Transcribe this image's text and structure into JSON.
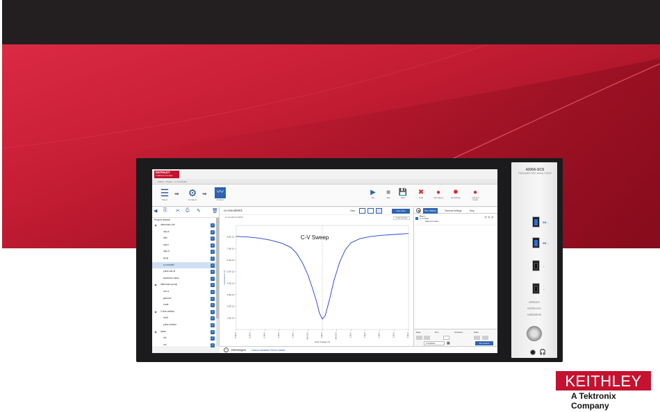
{
  "brand": {
    "name": "KEITHLEY",
    "tagline": "A Tektronix Company",
    "color": "#c41230"
  },
  "instrument": {
    "model": "4200A-SCS",
    "model_desc": "PARAMETER ANALYZER",
    "panel_labels": [
      "OPERATE",
      "INTERLOCK",
      "HARDDRIVE"
    ],
    "usb_tags": [
      "SS←",
      "SS←",
      "←",
      "←"
    ]
  },
  "screen": {
    "logo": "KEITHLEY",
    "logo_sub": "A Tektronix Company",
    "window_title": "Clarius - Project - cv-nmosfet#1",
    "toolbar": {
      "steps": [
        "Select",
        "Configure",
        "Analyze"
      ],
      "right_buttons": [
        "Run",
        "Stop",
        "Save",
        "Tools",
        "My Projects",
        "My Settings",
        "Learning Center"
      ]
    },
    "tree": {
      "tools": [
        "Copy",
        "Cut",
        "Paste",
        "Rename",
        "Delete"
      ],
      "project_label": "Project: default",
      "items": [
        {
          "label": "4terminal-n-fet",
          "level": 1,
          "group": true
        },
        {
          "label": "vds-id",
          "level": 2
        },
        {
          "label": "vtlin",
          "level": 2
        },
        {
          "label": "subvt",
          "level": 2
        },
        {
          "label": "vgs-id",
          "level": 2
        },
        {
          "label": "ig-vg",
          "level": 2
        },
        {
          "label": "cv-nmosfet",
          "level": 2,
          "selected": true
        },
        {
          "label": "pulse-vds-id",
          "level": 2
        },
        {
          "label": "waveform-meas",
          "level": 2
        },
        {
          "label": "3terminal-npn-bjt",
          "level": 1,
          "group": true
        },
        {
          "label": "vce-ic",
          "level": 2
        },
        {
          "label": "gummel",
          "level": 2
        },
        {
          "label": "vcsat",
          "level": 2
        },
        {
          "label": "2-wire-resistor",
          "level": 1,
          "group": true
        },
        {
          "label": "res2t",
          "level": 2
        },
        {
          "label": "pulse-resistor",
          "level": 2
        },
        {
          "label": "diode",
          "level": 1,
          "group": true
        },
        {
          "label": "vfd",
          "level": 2
        },
        {
          "label": "vrd",
          "level": 2
        }
      ]
    },
    "graph": {
      "name": "cv-nmosfet#1",
      "view_label": "View:",
      "save_label": "Save Data",
      "options_label": "Graph Settings",
      "subtitle": "cv-nmosfet (Graph)"
    },
    "messages": {
      "label": "Messages",
      "text": "Clarius Hardware Server started"
    },
    "right_pane": {
      "tabs": [
        "Run History",
        "Terminal Settings",
        "Help"
      ],
      "run_title": "Run 1",
      "run_line1": "cv-nmosfet",
      "run_line2": "Reference Data",
      "bottom_labels": [
        "Date",
        "Run",
        "Checked",
        "Stars"
      ],
      "date_value": "7/13/2016",
      "search_label": "Run Search"
    }
  },
  "chart_data": {
    "type": "line",
    "title": "C-V Sweep",
    "x": [
      -3.0,
      -2.6,
      -2.2,
      -1.8,
      -1.4,
      -1.1,
      -0.9,
      -0.7,
      -0.5,
      -0.35,
      -0.2,
      -0.1,
      0.0,
      0.1,
      0.25,
      0.4,
      0.6,
      0.8,
      1.0,
      1.3,
      1.7,
      2.1,
      2.5,
      3.0
    ],
    "values": [
      8.05,
      8.0,
      7.9,
      7.72,
      7.45,
      7.1,
      6.6,
      5.8,
      4.7,
      3.6,
      2.4,
      1.4,
      0.9,
      1.2,
      2.6,
      4.2,
      5.8,
      6.9,
      7.5,
      7.85,
      8.05,
      8.15,
      8.22,
      8.3
    ],
    "xlim": [
      -3.0,
      3.0
    ],
    "ylim": [
      0,
      9
    ],
    "grid": false,
    "series_color": "#1f3fcf",
    "y_ticks": [
      "8.0E-12",
      "7.0E-12",
      "6.0E-12",
      "5.0E-12",
      "4.0E-12",
      "3.0E-12",
      "2.0E-12",
      "1.0E-12"
    ],
    "x_ticks": [
      "-3.0E+0",
      "-2.5E+0",
      "-2.0E+0",
      "-1.5E+0",
      "-1.0E+0",
      "-500.0E-3",
      "0.0E+0",
      "500.0E-3",
      "1.0E+0",
      "1.5E+0",
      "2.0E+0",
      "2.5E+0",
      "3.0E+0"
    ],
    "xlabel": "Gate Voltage (V)",
    "ylabel": "Capacitance (F)"
  }
}
